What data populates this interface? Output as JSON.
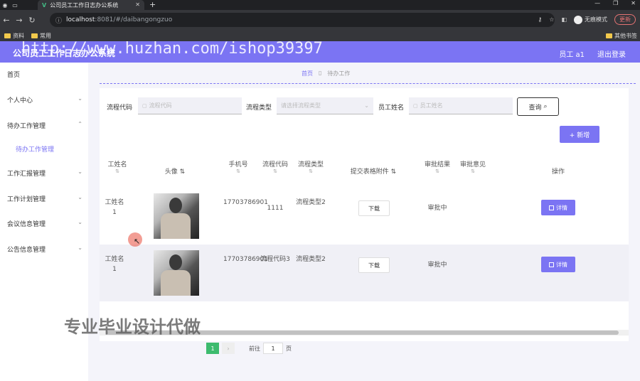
{
  "browser": {
    "tab_title": "公司员工工作日志办公系统",
    "tab_logo": "V",
    "url_host": "localhost",
    "url_path": ":8081/#/daibangongzuo",
    "incognito_label": "无痕模式",
    "update_label": "更新",
    "bookmarks": [
      "资料",
      "常用"
    ],
    "bookmarks_right": "其他书签"
  },
  "header": {
    "title": "公司员工工作日志办公系统",
    "watermark": "http://www.huzhan.com/ishop39397",
    "user": "员工 a1",
    "logout": "退出登录",
    "accent": "#7b74f3"
  },
  "sidebar": {
    "items": [
      {
        "label": "首页",
        "has_chevron": false
      },
      {
        "label": "个人中心",
        "has_chevron": true
      },
      {
        "label": "待办工作管理",
        "has_chevron": true
      },
      {
        "label": "工作汇报管理",
        "has_chevron": true
      },
      {
        "label": "工作计划管理",
        "has_chevron": true
      },
      {
        "label": "会议信息管理",
        "has_chevron": true
      },
      {
        "label": "公告信息管理",
        "has_chevron": true
      }
    ],
    "sub_item": "待办工作管理"
  },
  "breadcrumb": {
    "home": "首页",
    "current": "待办工作"
  },
  "filters": {
    "process_code_label": "流程代码",
    "process_code_placeholder": "流程代码",
    "process_type_label": "流程类型",
    "process_type_placeholder": "请选择流程类型",
    "employee_name_label": "员工姓名",
    "employee_name_placeholder": "员工姓名",
    "query_button": "查询"
  },
  "add_button": "+ 新增",
  "table": {
    "headers": [
      "工姓名",
      "头像",
      "手机号",
      "流程代码",
      "流程类型",
      "提交表格附件",
      "审批结果",
      "审批意见",
      "操作"
    ],
    "rows": [
      {
        "name": "工姓名1",
        "phone": "17703786901",
        "code": "1111",
        "type": "流程类型2",
        "download": "下载",
        "result": "审批中",
        "opinion": "",
        "detail": "详情"
      },
      {
        "name": "工姓名1",
        "phone": "17703786901",
        "code": "流程代码3",
        "type": "流程类型2",
        "download": "下载",
        "result": "审批中",
        "opinion": "",
        "detail": "详情"
      }
    ]
  },
  "pagination": {
    "page": "1",
    "goto_label": "前往",
    "goto_value": "1",
    "page_suffix": "页"
  },
  "overlay_text": "专业毕业设计代做"
}
